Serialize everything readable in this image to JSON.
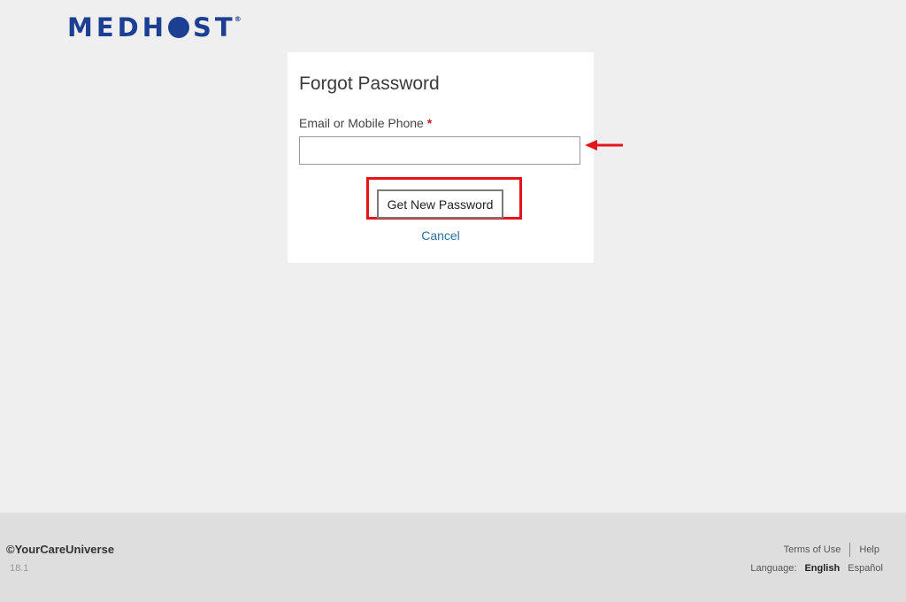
{
  "brand": {
    "logo_text_left": "MEDH",
    "logo_text_right": "ST",
    "logo_mark": "®"
  },
  "form": {
    "title": "Forgot Password",
    "field_label": "Email or Mobile Phone",
    "required_marker": "*",
    "input_value": "",
    "input_placeholder": "",
    "submit_label": "Get New Password",
    "cancel_label": "Cancel"
  },
  "annotations": {
    "highlight_color": "#e5141b",
    "arrow_icon": "left-arrow-icon"
  },
  "footer": {
    "copyright": "©YourCareUniverse",
    "version": "18.1",
    "terms_label": "Terms of Use",
    "help_label": "Help",
    "language_label": "Language:",
    "language_current": "English",
    "language_alt": "Español"
  },
  "colors": {
    "brand_blue": "#1c3f94",
    "link_blue": "#2c6f9c",
    "required_red": "#cc1f1f"
  }
}
